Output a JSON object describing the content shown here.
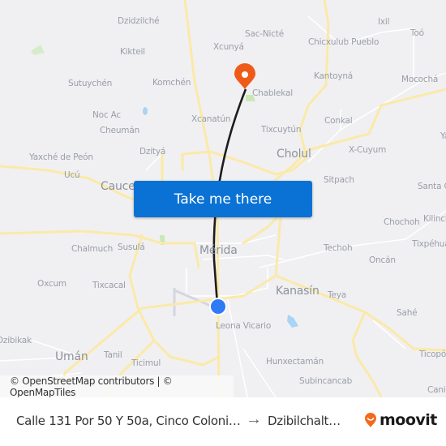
{
  "map": {
    "places": [
      {
        "name": "Dzidzilché",
        "size": "small"
      },
      {
        "name": "Kikteil",
        "size": "small"
      },
      {
        "name": "Sutuychén",
        "size": "small"
      },
      {
        "name": "Komchén",
        "size": "small"
      },
      {
        "name": "Noc Ac",
        "size": "small"
      },
      {
        "name": "Cheumán",
        "size": "small"
      },
      {
        "name": "Dzityá",
        "size": "small"
      },
      {
        "name": "Yaxché de Peón",
        "size": "small"
      },
      {
        "name": "Ucú",
        "size": "small"
      },
      {
        "name": "Caucel",
        "size": "big"
      },
      {
        "name": "Xcunyá",
        "size": "small"
      },
      {
        "name": "Sac-Nicté",
        "size": "small"
      },
      {
        "name": "Chicxulub Pueblo",
        "size": "small"
      },
      {
        "name": "Ixil",
        "size": "small"
      },
      {
        "name": "Toó",
        "size": "small"
      },
      {
        "name": "Kantoyná",
        "size": "small"
      },
      {
        "name": "Mocochá",
        "size": "small"
      },
      {
        "name": "Chablekal",
        "size": "small"
      },
      {
        "name": "Xcanatún",
        "size": "small"
      },
      {
        "name": "Conkal",
        "size": "small"
      },
      {
        "name": "Tixcuytún",
        "size": "small"
      },
      {
        "name": "Cholul",
        "size": "big"
      },
      {
        "name": "X-Cuyum",
        "size": "small"
      },
      {
        "name": "Yaxkukul",
        "size": "small"
      },
      {
        "name": "Sitpach",
        "size": "small"
      },
      {
        "name": "Santa Cruz",
        "size": "small"
      },
      {
        "name": "Chochoh",
        "size": "small"
      },
      {
        "name": "Kilinché",
        "size": "small"
      },
      {
        "name": "Tixpéhual",
        "size": "small"
      },
      {
        "name": "Chalmuch",
        "size": "small"
      },
      {
        "name": "Susulá",
        "size": "small"
      },
      {
        "name": "Mérida",
        "size": "big"
      },
      {
        "name": "Techoh",
        "size": "small"
      },
      {
        "name": "Oncán",
        "size": "small"
      },
      {
        "name": "Oxcum",
        "size": "small"
      },
      {
        "name": "Tixcacal",
        "size": "small"
      },
      {
        "name": "Kanasín",
        "size": "big"
      },
      {
        "name": "Teya",
        "size": "small"
      },
      {
        "name": "Sahé",
        "size": "small"
      },
      {
        "name": "Leona Vicario",
        "size": "small"
      },
      {
        "name": "Dzibikak",
        "size": "small"
      },
      {
        "name": "Umán",
        "size": "big"
      },
      {
        "name": "Tanil",
        "size": "small"
      },
      {
        "name": "Ticimul",
        "size": "small"
      },
      {
        "name": "Hunxectamán",
        "size": "small"
      },
      {
        "name": "Subincancab",
        "size": "small"
      },
      {
        "name": "Ticopó",
        "size": "small"
      },
      {
        "name": "Canicab",
        "size": "small"
      }
    ],
    "take_me_there_label": "Take me there",
    "attribution": "© OpenStreetMap contributors | © OpenMapTiles",
    "colors": {
      "destination_pin": "#f05a19",
      "origin_dot": "#2f7bf5",
      "route_line": "#1d1d1d",
      "button": "#0a72d4",
      "road_major": "#fbe9a8"
    }
  },
  "footer": {
    "origin": "Calle 131 Por 50 Y 50a, Cinco Coloni…",
    "arrow_icon": "arrow-right-icon",
    "destination": "Dzibilchalt…",
    "brand": "moovit"
  }
}
